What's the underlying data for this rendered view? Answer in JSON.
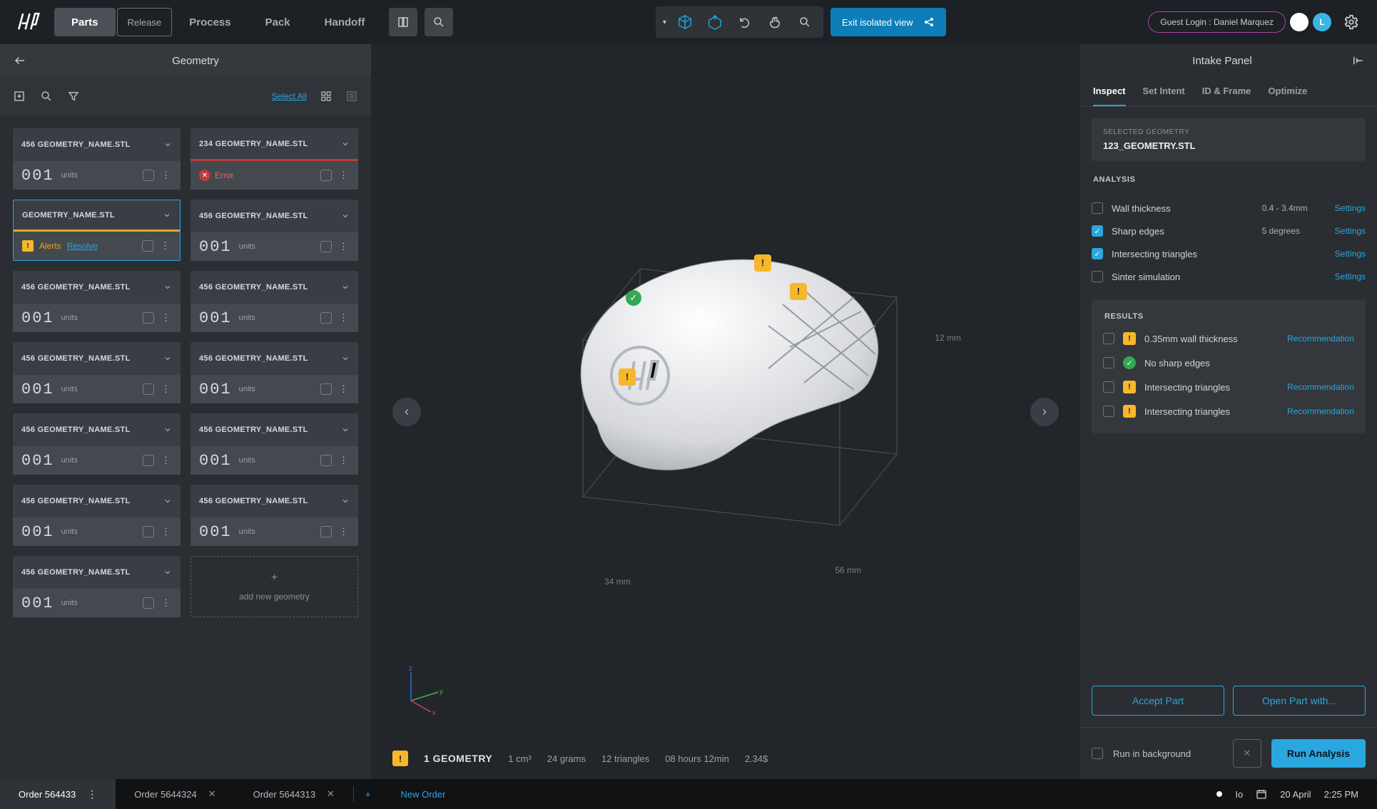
{
  "top": {
    "tabs": [
      "Parts",
      "Release",
      "Process",
      "Pack",
      "Handoff"
    ],
    "active_tab": "Parts",
    "exit_iso_label": "Exit isolated view",
    "guest_label": "Guest Login : Daniel Marquez",
    "avatar2_initial": "L"
  },
  "left": {
    "title": "Geometry",
    "select_all": "Select All",
    "add_label": "add new geometry",
    "cards": [
      {
        "name": "456 GEOMETRY_NAME.STL",
        "units": "001",
        "units_label": "units",
        "state": "normal"
      },
      {
        "name": "234 GEOMETRY_NAME.STL",
        "units": "",
        "units_label": "",
        "state": "error",
        "err_text": "Error"
      },
      {
        "name": "GEOMETRY_NAME.STL",
        "units": "",
        "units_label": "",
        "state": "selected",
        "alerts_text": "Alerts",
        "resolve": "Resolve"
      },
      {
        "name": "456 GEOMETRY_NAME.STL",
        "units": "001",
        "units_label": "units",
        "state": "normal"
      },
      {
        "name": "456 GEOMETRY_NAME.STL",
        "units": "001",
        "units_label": "units",
        "state": "normal"
      },
      {
        "name": "456 GEOMETRY_NAME.STL",
        "units": "001",
        "units_label": "units",
        "state": "normal"
      },
      {
        "name": "456 GEOMETRY_NAME.STL",
        "units": "001",
        "units_label": "units",
        "state": "normal"
      },
      {
        "name": "456 GEOMETRY_NAME.STL",
        "units": "001",
        "units_label": "units",
        "state": "normal"
      },
      {
        "name": "456 GEOMETRY_NAME.STL",
        "units": "001",
        "units_label": "units",
        "state": "normal"
      },
      {
        "name": "456 GEOMETRY_NAME.STL",
        "units": "001",
        "units_label": "units",
        "state": "normal"
      },
      {
        "name": "456 GEOMETRY_NAME.STL",
        "units": "001",
        "units_label": "units",
        "state": "normal"
      },
      {
        "name": "456 GEOMETRY_NAME.STL",
        "units": "001",
        "units_label": "units",
        "state": "normal"
      },
      {
        "name": "456 GEOMETRY_NAME.STL",
        "units": "001",
        "units_label": "units",
        "state": "normal"
      }
    ]
  },
  "viewport": {
    "dims": {
      "x": "34 mm",
      "y": "56 mm",
      "z": "12 mm"
    },
    "axis": {
      "x": "x",
      "y": "y",
      "z": "z"
    },
    "footer": {
      "title": "1 GEOMETRY",
      "stat1": "1 cm³",
      "stat2": "24 grams",
      "stat3": "12 triangles",
      "stat4": "08 hours 12min",
      "stat5": "2.34$"
    }
  },
  "right": {
    "title": "Intake Panel",
    "tabs": [
      "Inspect",
      "Set Intent",
      "ID & Frame",
      "Optimize"
    ],
    "active_tab": "Inspect",
    "selected": {
      "label": "SELECTED GEOMETRY",
      "value": "123_GEOMETRY.STL"
    },
    "analysis_label": "ANALYSIS",
    "analysis": [
      {
        "label": "Wall thickness",
        "value": "0.4 - 3.4mm",
        "checked": false,
        "settings": "Settings"
      },
      {
        "label": "Sharp edges",
        "value": "5 degrees",
        "checked": true,
        "settings": "Settings"
      },
      {
        "label": "Intersecting triangles",
        "value": "",
        "checked": true,
        "settings": "Settings"
      },
      {
        "label": "Sinter simulation",
        "value": "",
        "checked": false,
        "settings": "Settings"
      }
    ],
    "results_label": "RESULTS",
    "results": [
      {
        "icon": "warn",
        "label": "0.35mm wall thickness",
        "rec": "Recommendation"
      },
      {
        "icon": "ok",
        "label": "No sharp edges",
        "rec": ""
      },
      {
        "icon": "warn",
        "label": "Intersecting triangles",
        "rec": "Recommendation"
      },
      {
        "icon": "warn",
        "label": "Intersecting triangles",
        "rec": "Recommendation"
      }
    ],
    "btn_accept": "Accept Part",
    "btn_openwith": "Open Part with...",
    "run_bg": "Run in background",
    "btn_run": "Run Analysis"
  },
  "bottom": {
    "tabs": [
      {
        "label": "Order 564433",
        "active": true,
        "closable": false,
        "more": true
      },
      {
        "label": "Order 5644324",
        "active": false,
        "closable": true
      },
      {
        "label": "Order 5644313",
        "active": false,
        "closable": true
      }
    ],
    "new_label": "New Order",
    "status": {
      "io": "Io",
      "date": "20 April",
      "time": "2:25 PM"
    }
  }
}
